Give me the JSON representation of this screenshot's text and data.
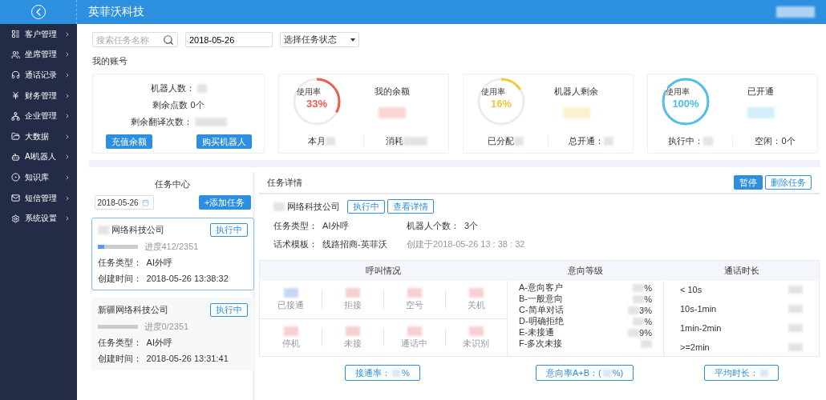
{
  "header": {
    "title": "英菲沃科技"
  },
  "sidebar": {
    "items": [
      {
        "label": "客户管理"
      },
      {
        "label": "坐席管理"
      },
      {
        "label": "通话记录"
      },
      {
        "label": "财务管理"
      },
      {
        "label": "企业管理"
      },
      {
        "label": "大数据"
      },
      {
        "label": "AI机器人"
      },
      {
        "label": "知识库"
      },
      {
        "label": "短信管理"
      },
      {
        "label": "系统设置"
      }
    ]
  },
  "filters": {
    "search": {
      "placeholder": "搜索任务名称"
    },
    "date": {
      "value": "2018-05-26"
    },
    "status": {
      "value": "选择任务状态"
    }
  },
  "account": {
    "title": "我的账号",
    "lines": [
      {
        "text": "机器人数：",
        "blurred": true
      },
      {
        "text": "剩余点数 0个",
        "blurred": false
      },
      {
        "text": "剩余翻译次数：",
        "blurred": true
      }
    ],
    "buttons": [
      "充值余额",
      "购买机器人"
    ]
  },
  "gauges": [
    {
      "caption": "使用率",
      "reading": "33%",
      "level": 0.33,
      "color": "#ee5d52",
      "title": "我的余额",
      "footer": [
        {
          "text": "本月",
          "blurred": true
        },
        {
          "text": "消耗",
          "blurred": true
        }
      ]
    },
    {
      "caption": "使用率",
      "reading": "16%",
      "level": 0.16,
      "color": "#f3c93a",
      "title": "机器人剩余",
      "footer": [
        {
          "text": "已分配",
          "blurred": true
        },
        {
          "text": "总开通：",
          "blurred": true
        }
      ]
    },
    {
      "caption": "使用率",
      "reading": "100%",
      "level": 1,
      "color": "#4dbfe8",
      "title": "已开通",
      "footer": [
        {
          "text": "执行中：",
          "blurred": true
        },
        {
          "text": "空闲：0个",
          "blurred": false
        }
      ]
    }
  ],
  "tasks": {
    "title": "任务中心",
    "date": "2018-05-26",
    "add_button": "+添加任务",
    "items": [
      {
        "company": "网络科技公司",
        "blurred": true,
        "status": "执行中",
        "level": 0.175,
        "progress": "进度412/2351",
        "type": "任务类型：  AI外呼",
        "created": "创建时间：  2018-05-26 13:38:32",
        "selected": true
      },
      {
        "company": "新疆网络科技公司",
        "blurred": false,
        "status": "执行中",
        "level": 0,
        "progress": "进度0/2351",
        "type": "任务类型：  AI外呼",
        "created": "创建时间：  2018-05-26 13:31:41",
        "selected": false
      }
    ]
  },
  "detail": {
    "title": "任务详情",
    "actions": [
      {
        "label": "暂停",
        "primary": true
      },
      {
        "label": "删除任务",
        "primary": false
      }
    ],
    "company": "网络科技公司",
    "status": "执行中",
    "view_button": "查看详情",
    "fields": [
      {
        "text": "任务类型：  AI外呼",
        "muted": false
      },
      {
        "text": "机器人个数：  3个",
        "muted": false
      },
      {
        "text": "话术模板：  线路招商-英菲沃",
        "muted": false
      },
      {
        "text": "创建于2018-05-26 13 : 38 : 32",
        "muted": true
      }
    ]
  },
  "stats": {
    "columns": [
      "呼叫情况",
      "意向等级",
      "通话时长"
    ],
    "calls": [
      {
        "label": "已接通",
        "color": "#b9cdf3"
      },
      {
        "label": "拒接",
        "color": "#f6c3c6"
      },
      {
        "label": "空号",
        "color": "#f6c3c6"
      },
      {
        "label": "关机",
        "color": "#f6c3c6"
      },
      {
        "label": "停机",
        "color": "#f6c3c6"
      },
      {
        "label": "未接",
        "color": "#f6c3c6"
      },
      {
        "label": "通话中",
        "color": "#f6c3c6"
      },
      {
        "label": "未识别",
        "color": "#f6c3c6"
      }
    ],
    "intents": [
      {
        "label": "A-意向客户",
        "value": "%"
      },
      {
        "label": "B-一般意向",
        "value": "%"
      },
      {
        "label": "C-简单对话",
        "value": "3%"
      },
      {
        "label": "D-明确拒绝",
        "value": "%"
      },
      {
        "label": "E-未接通",
        "value": "9%"
      },
      {
        "label": "F-多次未接"
      }
    ],
    "durations": [
      "< 10s",
      "10s-1min",
      "1min-2min",
      ">=2min"
    ],
    "buttons": [
      {
        "prefix": "接通率：",
        "suffix": "%"
      },
      {
        "prefix": "意向率A+B：(",
        "suffix": "%)"
      },
      {
        "prefix": "平均时长："
      }
    ]
  }
}
